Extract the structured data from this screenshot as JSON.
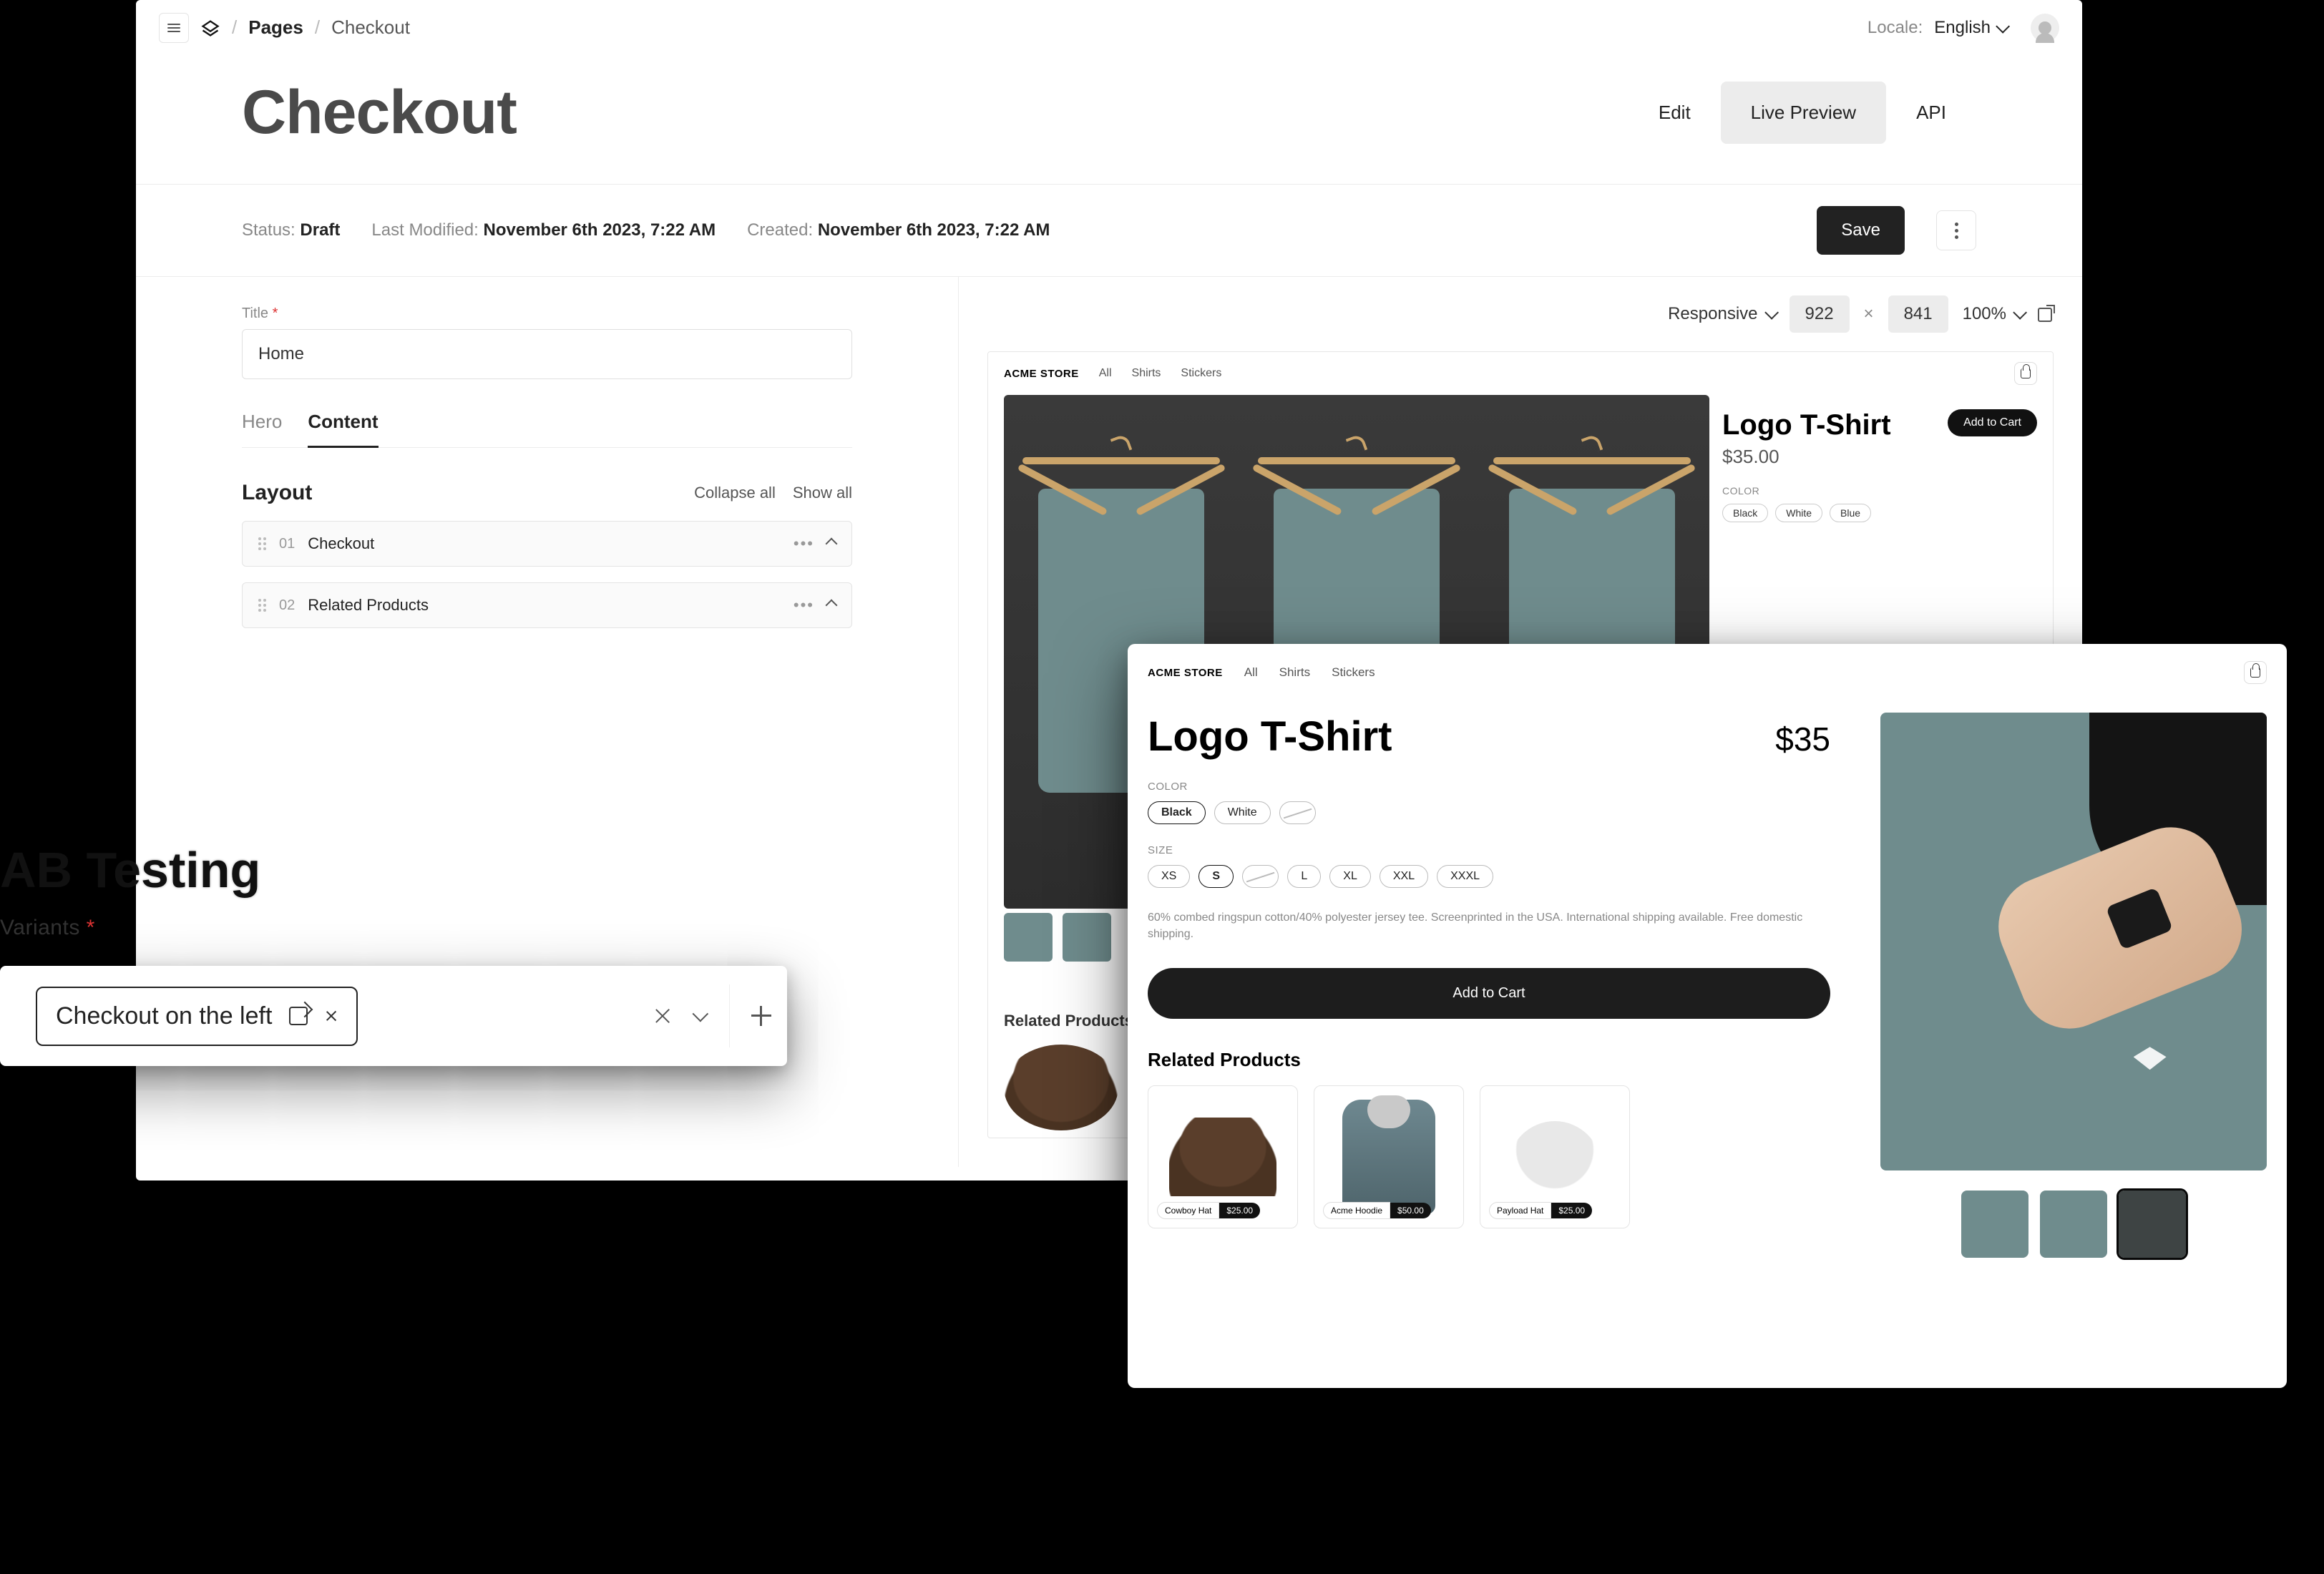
{
  "breadcrumbs": {
    "root": "Pages",
    "current": "Checkout"
  },
  "locale": {
    "label": "Locale:",
    "value": "English"
  },
  "page_title": "Checkout",
  "view_tabs": {
    "edit": "Edit",
    "live_preview": "Live Preview",
    "api": "API",
    "active": "live_preview"
  },
  "meta": {
    "status_label": "Status:",
    "status_value": "Draft",
    "modified_label": "Last Modified:",
    "modified_value": "November 6th 2023, 7:22 AM",
    "created_label": "Created:",
    "created_value": "November 6th 2023, 7:22 AM",
    "save": "Save"
  },
  "side": {
    "title_label": "Title",
    "title_value": "Home",
    "tabs": {
      "hero": "Hero",
      "content": "Content",
      "active": "content"
    },
    "layout_title": "Layout",
    "collapse_all": "Collapse all",
    "show_all": "Show all",
    "blocks": [
      {
        "idx": "01",
        "name": "Checkout"
      },
      {
        "idx": "02",
        "name": "Related Products"
      }
    ]
  },
  "canvas": {
    "responsive": "Responsive",
    "width": "922",
    "height": "841",
    "zoom": "100%",
    "store": {
      "brand": "ACME STORE",
      "nav": [
        "All",
        "Shirts",
        "Stickers"
      ],
      "product_title": "Logo T-Shirt",
      "add_to_cart": "Add to Cart",
      "price": "$35.00",
      "color_label": "COLOR",
      "colors": [
        "Black",
        "White",
        "Blue"
      ],
      "related_title": "Related Products"
    }
  },
  "ab": {
    "heading_fragment": "AB Testing",
    "variants_label": "Variants",
    "chip_text": "Checkout on the left"
  },
  "preview": {
    "brand": "ACME STORE",
    "nav": [
      "All",
      "Shirts",
      "Stickers"
    ],
    "title": "Logo T-Shirt",
    "price": "$35",
    "color_label": "COLOR",
    "colors": [
      {
        "name": "Black",
        "state": "sel"
      },
      {
        "name": "White",
        "state": ""
      },
      {
        "name": "",
        "state": "na"
      }
    ],
    "size_label": "SIZE",
    "sizes": [
      {
        "name": "XS",
        "state": ""
      },
      {
        "name": "S",
        "state": "sel"
      },
      {
        "name": "",
        "state": "na"
      },
      {
        "name": "L",
        "state": ""
      },
      {
        "name": "XL",
        "state": ""
      },
      {
        "name": "XXL",
        "state": ""
      },
      {
        "name": "XXXL",
        "state": ""
      }
    ],
    "description": "60% combed ringspun cotton/40% polyester jersey tee. Screenprinted in the USA. International shipping available. Free domestic shipping.",
    "add_to_cart": "Add to Cart",
    "related_title": "Related Products",
    "related": [
      {
        "name": "Cowboy Hat",
        "price": "$25.00"
      },
      {
        "name": "Acme Hoodie",
        "price": "$50.00"
      },
      {
        "name": "Payload Hat",
        "price": "$25.00"
      }
    ]
  }
}
